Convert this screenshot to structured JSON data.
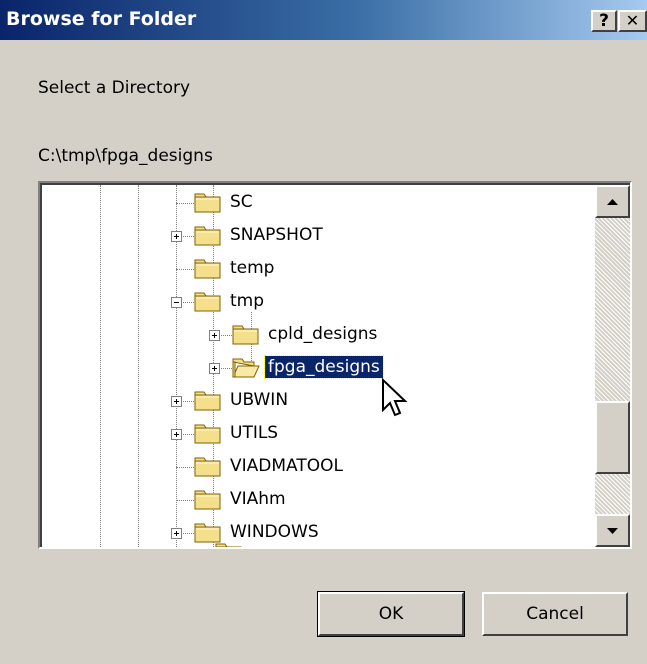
{
  "window": {
    "title": "Browse for Folder",
    "help_glyph": "?",
    "close_glyph": "✕"
  },
  "dialog": {
    "prompt": "Select a Directory",
    "current_path": "C:\\tmp\\fpga_designs"
  },
  "tree": {
    "items": [
      {
        "label": "SC",
        "expandable": false,
        "selected": false
      },
      {
        "label": "SNAPSHOT",
        "expandable": true,
        "expanded": false,
        "selected": false
      },
      {
        "label": "temp",
        "expandable": false,
        "selected": false
      },
      {
        "label": "tmp",
        "expandable": true,
        "expanded": true,
        "selected": false
      },
      {
        "label": "cpld_designs",
        "expandable": true,
        "expanded": false,
        "selected": false
      },
      {
        "label": "fpga_designs",
        "expandable": true,
        "expanded": false,
        "selected": true
      },
      {
        "label": "UBWIN",
        "expandable": true,
        "expanded": false,
        "selected": false
      },
      {
        "label": "UTILS",
        "expandable": true,
        "expanded": false,
        "selected": false
      },
      {
        "label": "VIADMATOOL",
        "expandable": false,
        "selected": false
      },
      {
        "label": "VIAhm",
        "expandable": false,
        "selected": false
      },
      {
        "label": "WINDOWS",
        "expandable": true,
        "expanded": false,
        "selected": false
      }
    ]
  },
  "buttons": {
    "ok": "OK",
    "cancel": "Cancel"
  },
  "icons": {
    "folder": "folder-icon",
    "open_folder": "open-folder-icon",
    "scroll_up": "scroll-up-arrow-icon",
    "scroll_down": "scroll-down-arrow-icon",
    "cursor": "mouse-pointer-icon"
  },
  "colors": {
    "title_bar": "#0a246a",
    "selection": "#0a246a",
    "face": "#d4d0c8",
    "folder_yellow": "#f4e08c"
  }
}
